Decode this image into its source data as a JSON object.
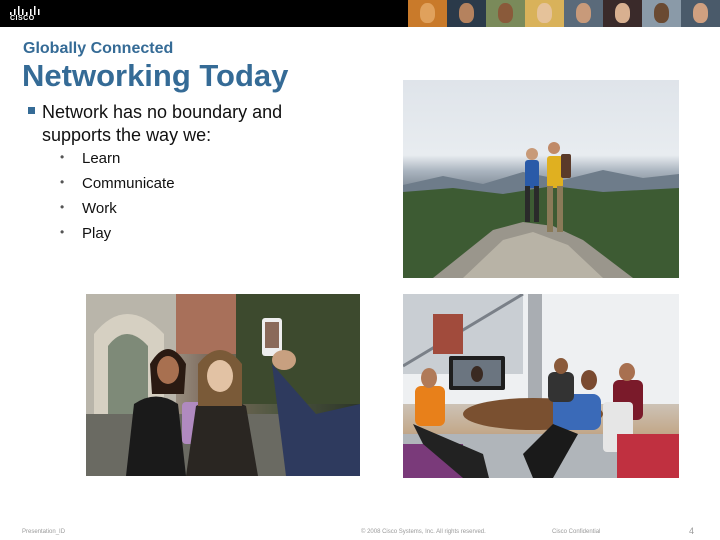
{
  "header": {
    "logo_text": "CISCO",
    "logo_color": "#ffffff",
    "bar_color": "#000000"
  },
  "slide": {
    "subtitle": "Globally Connected",
    "title": "Networking Today",
    "main_bullet": "Network has no boundary and\nsupports the way we:",
    "sub_bullets": [
      {
        "marker": "•",
        "label": "Learn"
      },
      {
        "marker": "•",
        "label": "Communicate"
      },
      {
        "marker": "•",
        "label": "Work"
      },
      {
        "marker": "•",
        "label": "Play"
      }
    ],
    "title_color": "#356b96"
  },
  "photos": [
    {
      "name": "photo-hikers-mountain"
    },
    {
      "name": "photo-friends-selfie"
    },
    {
      "name": "photo-video-meeting"
    }
  ],
  "footer": {
    "presentation_id": "Presentation_ID",
    "copyright": "© 2008 Cisco Systems, Inc. All rights reserved.",
    "confidential": "Cisco Confidential",
    "page_number": "4"
  }
}
